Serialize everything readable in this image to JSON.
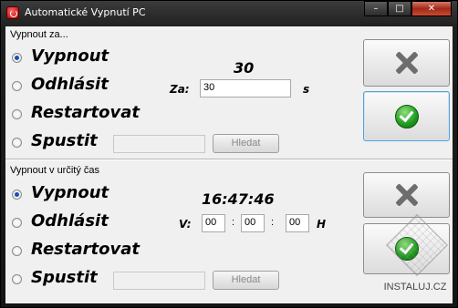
{
  "window": {
    "title": "Automatické Vypnutí PC"
  },
  "caption": {
    "minimize": "–",
    "maximize": "□",
    "close": "✕"
  },
  "section1": {
    "label": "Vypnout za...",
    "options": [
      "Vypnout",
      "Odhlásit",
      "Restartovat",
      "Spustit"
    ],
    "selected": 0,
    "seconds_display": "30",
    "za_label": "Za:",
    "seconds_value": "30",
    "unit": "s",
    "run_path_value": "",
    "browse_label": "Hledat"
  },
  "section2": {
    "label": "Vypnout v určitý čas",
    "options": [
      "Vypnout",
      "Odhlásit",
      "Restartovat",
      "Spustit"
    ],
    "selected": 0,
    "clock_display": "16:47:46",
    "time_label": "V:",
    "hours": "00",
    "minutes": "00",
    "seconds": "00",
    "separator": ":",
    "unit": "H",
    "run_path_value": "",
    "browse_label": "Hledat"
  },
  "watermark": {
    "text": "INSTALUJ.CZ"
  },
  "icons": {
    "cancel": "x-icon",
    "confirm": "checkmark-icon",
    "app": "power-icon",
    "confirm_color": "#22a022",
    "cancel_color": "#6d6d6d"
  }
}
